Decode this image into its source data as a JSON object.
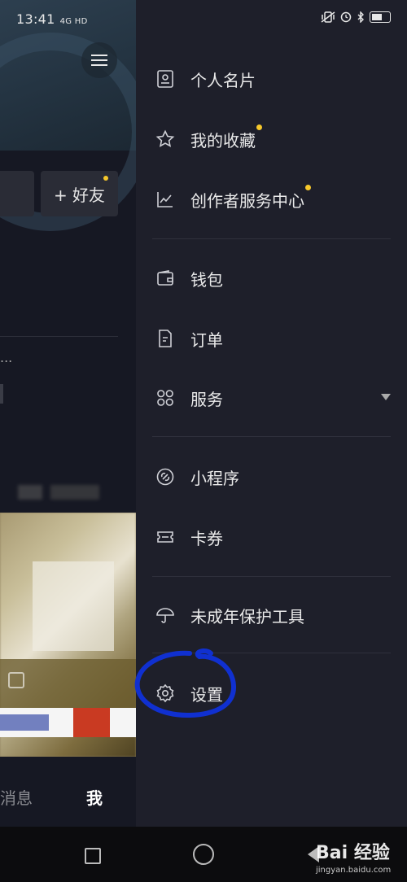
{
  "status_bar": {
    "time": "13:41",
    "signal_text": "4G HD",
    "right_icons": [
      "vibrate-icon",
      "alarm-icon",
      "bluetooth-icon",
      "battery-icon"
    ]
  },
  "background": {
    "add_friend_label": "+ 好友",
    "ellipsis": "...",
    "tab_messages": "消息",
    "tab_me": "我"
  },
  "drawer": {
    "items": [
      {
        "label": "个人名片",
        "icon": "profile-card-icon",
        "dot": false
      },
      {
        "label": "我的收藏",
        "icon": "star-icon",
        "dot": true
      },
      {
        "label": "创作者服务中心",
        "icon": "chart-line-icon",
        "dot": true
      },
      {
        "label": "钱包",
        "icon": "wallet-icon",
        "dot": false
      },
      {
        "label": "订单",
        "icon": "document-icon",
        "dot": false
      },
      {
        "label": "服务",
        "icon": "grid-icon",
        "dot": false,
        "expandable": true
      },
      {
        "label": "小程序",
        "icon": "mini-program-icon",
        "dot": false
      },
      {
        "label": "卡券",
        "icon": "ticket-icon",
        "dot": false
      },
      {
        "label": "未成年保护工具",
        "icon": "umbrella-icon",
        "dot": false
      },
      {
        "label": "设置",
        "icon": "gear-icon",
        "dot": false
      }
    ]
  },
  "watermark": {
    "brand": "Bai 经验",
    "site": "jingyan.baidu.com"
  },
  "colors": {
    "notification_dot": "#f7c82b",
    "drawer_bg": "#1e1f2a",
    "annotation_circle": "#1030d0"
  }
}
